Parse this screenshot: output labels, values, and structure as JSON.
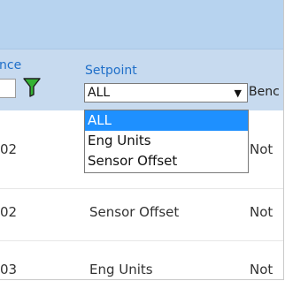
{
  "header": {
    "left_label": "nce",
    "setpoint_label": "Setpoint",
    "right_label": "Benc"
  },
  "filter": {
    "selected": "ALL",
    "options": [
      "ALL",
      "Eng Units",
      "Sensor Offset"
    ]
  },
  "rows": [
    {
      "num": "02",
      "setpoint": "",
      "bench": "Not"
    },
    {
      "num": "02",
      "setpoint": "Sensor Offset",
      "bench": "Not"
    },
    {
      "num": "03",
      "setpoint": "Eng Units",
      "bench": "Not"
    }
  ],
  "colors": {
    "top_strip": "#b7d3ef",
    "header_bg": "#c7daef",
    "label_blue": "#1f6fc9",
    "funnel_green": "#34b233",
    "selected_option": "#1e90ff"
  }
}
